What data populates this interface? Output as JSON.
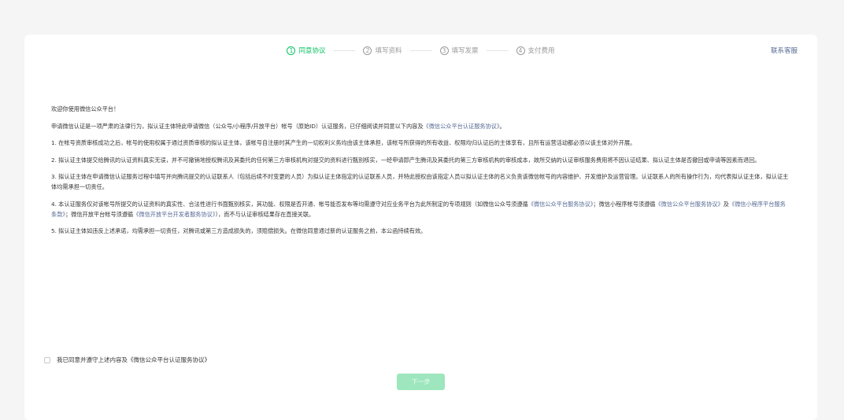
{
  "steps": [
    {
      "num": "1",
      "label": "同意协议",
      "active": true
    },
    {
      "num": "2",
      "label": "填写资料",
      "active": false
    },
    {
      "num": "3",
      "label": "填写发票",
      "active": false
    },
    {
      "num": "4",
      "label": "支付费用",
      "active": false
    }
  ],
  "contact_label": "联系客服",
  "content": {
    "greeting": "欢迎你使用微信公众平台！",
    "intro_a": "申请微信认证是一项严肃的法律行为，拟认证主体特此申请微信（公众号/小程序/开放平台）帐号（原始ID）认证服务，已仔细阅读并同意以下内容及",
    "intro_link": "《微信公众平台认证服务协议》",
    "intro_end": "。",
    "p1": "1. 在帐号资质审核成功之后，帐号的使用权属于通过资质审核的拟认证主体，该帐号自注册时其产生的一切权利义务均由该主体承担，该帐号所获得的所有收益、权限均归认证后的主体享有，且所有运营活动都必须以该主体对外开展。",
    "p2": "2. 拟认证主体提交给腾讯的认证资料真实无误，并不可撤销地授权腾讯及其委托的任何第三方审核机构对提交的资料进行甄别核实，一经申请即产生腾讯及其委托的第三方审核机构的审核成本，故所交纳的认证审核服务费用将不因认证结果、拟认证主体是否撤回或申请等因素而退回。",
    "p3": "3. 拟认证主体在申请微信认证服务过程中填写并向腾讯提交的认证联系人（包括后续不时变更的人员）为拟认证主体指定的认证联系人员，并特此授权由该指定人员以拟认证主体的名义负责该微信帐号的内容维护、开发维护及运营管理。认证联系人的所有操作行为，均代表拟认证主体，拟认证主体均需承担一切责任。",
    "p4_a": "4. 本认证服务仅对该帐号所提交的认证资料的真实性、合法性进行书面甄别核实，其功能、权限是否开通、帐号能否发布等均需遵守对应业务平台为此所制定的专项规则（如微信公众号须遵循",
    "p4_l1": "《微信公众平台服务协议》",
    "p4_b": "；微信小程序帐号须遵循",
    "p4_l2": "《微信公众平台服务协议》",
    "p4_c": "及",
    "p4_l3": "《微信小程序平台服务条款》",
    "p4_d": "；微信开放平台帐号须遵循",
    "p4_l4": "《微信开放平台开发者服务协议》",
    "p4_e": "），而不与认证审核结果存在直接关联。",
    "p5": "5. 拟认证主体如违反上述承诺，均需承担一切责任，对腾讯或第三方造成损失的，须赔偿损失。在微信同意通过新的认证服务之前，本公函持续有效。"
  },
  "agree": {
    "label": "我已同意并遵守上述内容及",
    "link": "《微信公众平台认证服务协议》"
  },
  "next_label": "下一步",
  "colors": {
    "accent": "#07c160",
    "link": "#576b95",
    "button_disabled": "#9ee6bd"
  }
}
